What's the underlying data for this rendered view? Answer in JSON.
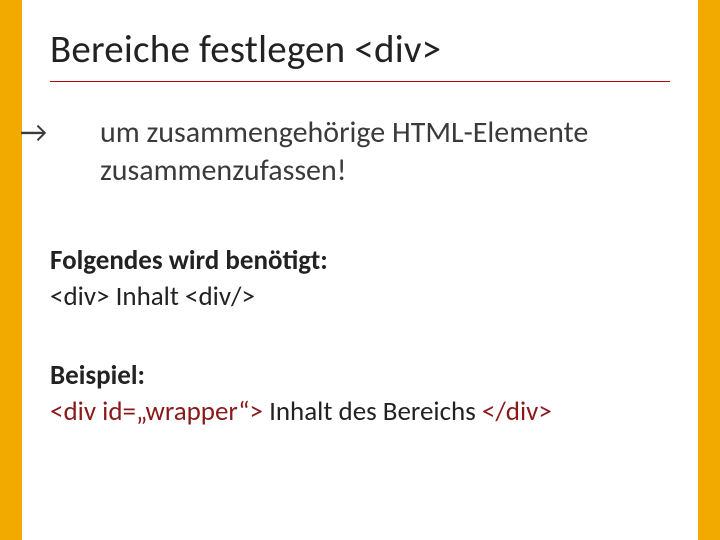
{
  "title": "Bereiche festlegen <div>",
  "lead": {
    "arrow": "→",
    "text": "um zusammengehörige HTML-Elemente zusammenzufassen!"
  },
  "needed": {
    "label": "Folgendes wird benötigt:",
    "code": "<div> Inhalt <div/>"
  },
  "example": {
    "label": "Beispiel:",
    "open": "<div id=„wrapper“>",
    "middle": " Inhalt des Bereichs ",
    "close": "</div>"
  }
}
